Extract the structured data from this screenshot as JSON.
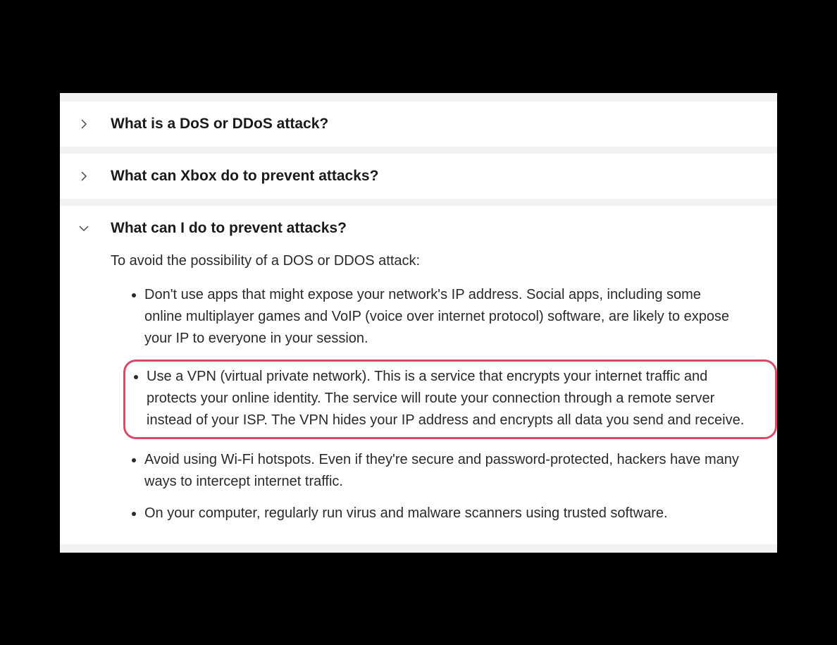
{
  "accordion": {
    "items": [
      {
        "title": "What is a DoS or DDoS attack?",
        "expanded": false
      },
      {
        "title": "What can Xbox do to prevent attacks?",
        "expanded": false
      },
      {
        "title": "What can I do to prevent attacks?",
        "expanded": true,
        "intro": "To avoid the possibility of a DOS or DDOS attack:",
        "bullets": [
          "Don't use apps that might expose your network's IP address. Social apps, including some online multiplayer games and VoIP (voice over internet protocol) software, are likely to expose your IP to everyone in your session.",
          "Use a VPN (virtual private network). This is a service that encrypts your internet traffic and protects your online identity. The service will route your connection through a remote server instead of your ISP. The VPN hides your IP address and encrypts all data you send and receive.",
          "Avoid using Wi-Fi hotspots. Even if they're secure and password-protected, hackers have many ways to intercept internet traffic.",
          "On your computer, regularly run virus and malware scanners using trusted software."
        ],
        "highlighted_index": 1
      }
    ]
  },
  "colors": {
    "highlight_border": "#d94a6a",
    "page_bg": "#f2f2f2",
    "item_bg": "#ffffff"
  }
}
